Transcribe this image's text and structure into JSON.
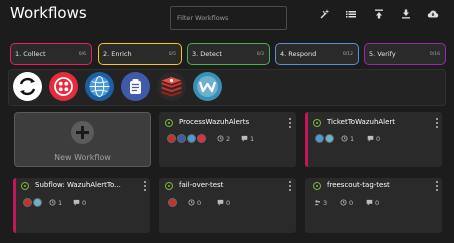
{
  "header": {
    "title": "Workflows",
    "search_placeholder": "Filter Workflows"
  },
  "toolbar": {
    "icons": [
      "magic-wand-icon",
      "list-icon",
      "upload-icon",
      "download-icon",
      "cloud-download-icon"
    ]
  },
  "stages": [
    {
      "label": "1. Collect",
      "count": "0/6",
      "color": "#e91e63"
    },
    {
      "label": "2. Enrich",
      "count": "0/5",
      "color": "#f5c518"
    },
    {
      "label": "3. Detect",
      "count": "0/3",
      "color": "#4caf50"
    },
    {
      "label": "4. Respond",
      "count": "0/12",
      "color": "#5c8fd6"
    },
    {
      "label": "5. Verify",
      "count": "0/16",
      "color": "#9c27b0"
    }
  ],
  "apps": [
    "shuffle-tools",
    "twilio",
    "http",
    "thehive",
    "redis",
    "wazuh"
  ],
  "new_workflow_label": "New Workflow",
  "workflows": [
    {
      "name": "ProcessWazuhAlerts",
      "triggers": "2",
      "executions": "1"
    },
    {
      "name": "TicketToWazuhAlert",
      "triggers": "1",
      "executions": "0"
    },
    {
      "name": "Subflow: WazuhAlertTo...",
      "triggers": "1",
      "executions": "0"
    },
    {
      "name": "fail-over-test",
      "triggers": "0",
      "executions": "0"
    },
    {
      "name": "freescout-tag-test",
      "users": "3",
      "triggers": "0",
      "executions": "0"
    }
  ],
  "colors": {
    "accent_border": "#c2185b",
    "workflow_status": "#7cb342"
  }
}
